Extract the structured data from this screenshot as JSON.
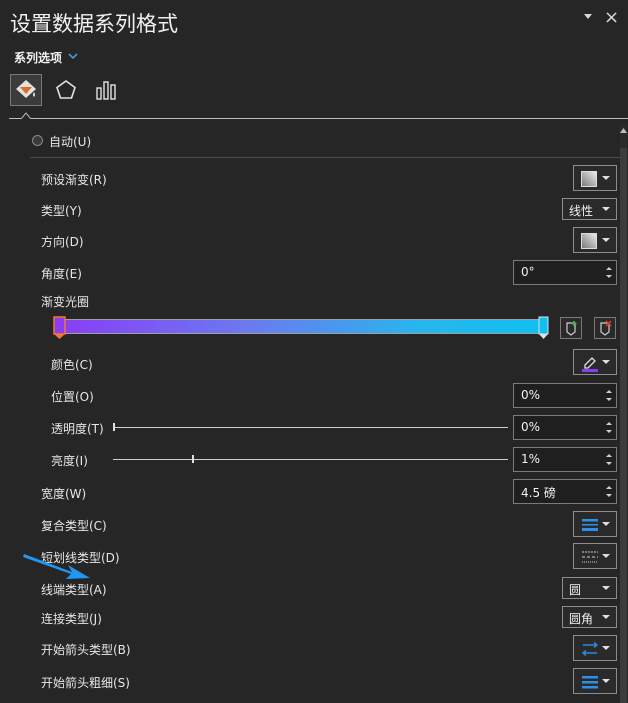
{
  "header": {
    "title": "设置数据系列格式",
    "series_options_label": "系列选项"
  },
  "tabs": [
    {
      "name": "fill-line",
      "icon": "paint-bucket-icon",
      "active": true
    },
    {
      "name": "effects",
      "icon": "pentagon-icon",
      "active": false
    },
    {
      "name": "series-options",
      "icon": "bar-chart-icon",
      "active": false
    }
  ],
  "fill": {
    "auto_label": "自动(U)",
    "preset_gradient_label": "预设渐变(R)",
    "type_label": "类型(Y)",
    "type_value": "线性",
    "direction_label": "方向(D)",
    "angle_label": "角度(E)",
    "angle_value": "0°",
    "gradient_stops_label": "渐变光圈",
    "color_label": "颜色(C)",
    "position_label": "位置(O)",
    "position_value": "0%",
    "transparency_label": "透明度(T)",
    "transparency_value": "0%",
    "transparency_level": 0,
    "brightness_label": "亮度(I)",
    "brightness_value": "1%",
    "brightness_level": 0.01,
    "gradient_start_color": "#8a3df5",
    "gradient_end_color": "#10c0f0"
  },
  "line": {
    "width_label": "宽度(W)",
    "width_value": "4.5 磅",
    "compound_label": "复合类型(C)",
    "dash_label": "短划线类型(D)",
    "cap_label": "线端类型(A)",
    "cap_value": "圆",
    "join_label": "连接类型(J)",
    "join_value": "圆角",
    "begin_arrow_type_label": "开始箭头类型(B)",
    "begin_arrow_size_label": "开始箭头粗细(S)"
  },
  "colors": {
    "accent": "#1e88e5",
    "annotation_arrow": "#2196f3"
  }
}
